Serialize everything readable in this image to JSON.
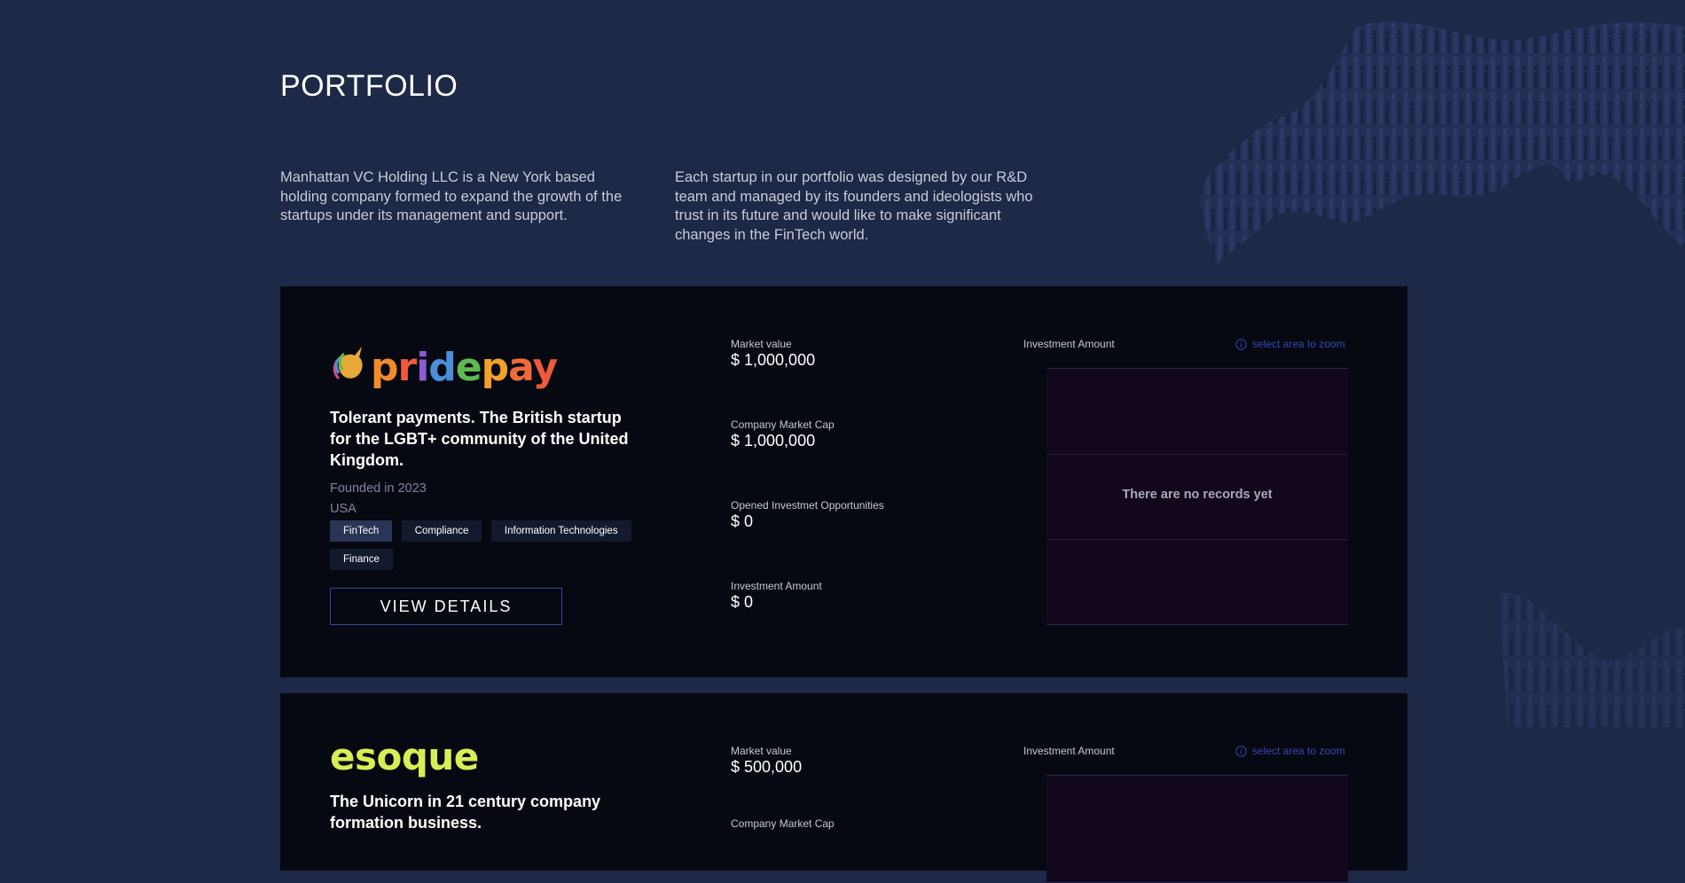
{
  "page": {
    "title": "PORTFOLIO",
    "intro_left": "Manhattan VC Holding LLC is a New York based holding company formed to expand the growth of the startups under its management and support.",
    "intro_right": "Each startup in our portfolio was designed by our R&D team and managed by its founders and ideologists who trust in its future and would like to make significant changes in the FinTech world."
  },
  "colors": {
    "background": "#1e2847",
    "card": "#070912",
    "accent": "#3844a3",
    "esoque_logo": "#d8ee54"
  },
  "companies": [
    {
      "logo_text": "pridepay",
      "tagline": "Tolerant payments. The British startup for the LGBT+ community of the United Kingdom.",
      "founded": "Founded in 2023",
      "country": "USA",
      "tags": [
        "FinTech",
        "Compliance",
        "Information Technologies",
        "Finance"
      ],
      "button_label": "VIEW DETAILS",
      "stats": [
        {
          "label": "Market value",
          "value": "$ 1,000,000"
        },
        {
          "label": "Company Market Cap",
          "value": "$ 1,000,000"
        },
        {
          "label": "Opened Investmet Opportunities",
          "value": "$ 0"
        },
        {
          "label": "Investment Amount",
          "value": "$ 0"
        }
      ],
      "chart": {
        "title": "Investment Amount",
        "zoom_hint": "select area to zoom",
        "empty_message": "There are no records yet"
      }
    },
    {
      "logo_text": "esoque",
      "tagline": "The Unicorn in 21 century company formation business.",
      "stats": [
        {
          "label": "Market value",
          "value": "$ 500,000"
        },
        {
          "label": "Company Market Cap",
          "value": ""
        }
      ],
      "chart": {
        "title": "Investment Amount",
        "zoom_hint": "select area to zoom"
      }
    }
  ]
}
